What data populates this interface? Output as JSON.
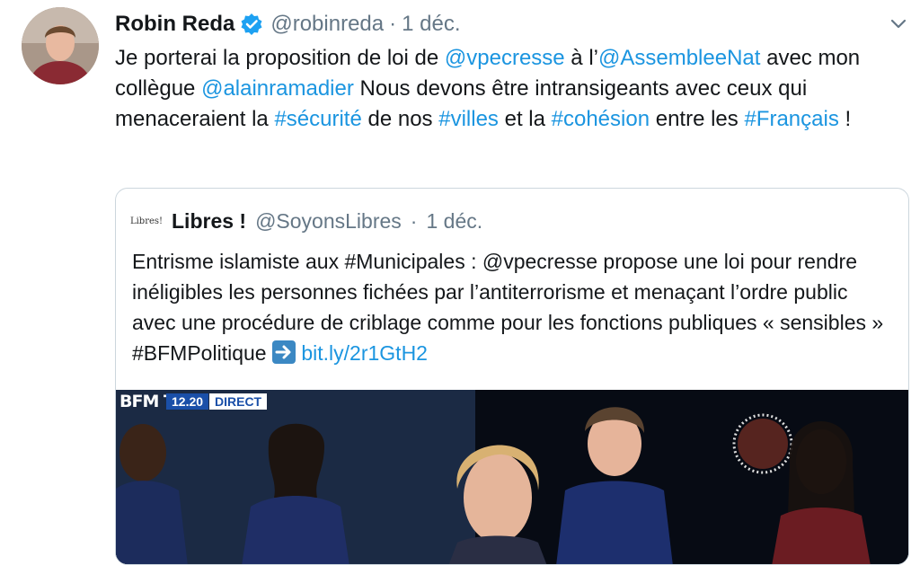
{
  "tweet": {
    "author_name": "Robin Reda",
    "handle": "@robinreda",
    "separator": "·",
    "date": "1 déc.",
    "text_parts": [
      {
        "t": "Je porterai la proposition de loi de ",
        "link": false
      },
      {
        "t": "@vpecresse",
        "link": true
      },
      {
        "t": " à l’",
        "link": false
      },
      {
        "t": "@AssembleeNat",
        "link": true
      },
      {
        "t": " avec mon collègue ",
        "link": false
      },
      {
        "t": "@alainramadier",
        "link": true
      },
      {
        "t": " Nous devons être intransigeants avec ceux qui menaceraient la ",
        "link": false
      },
      {
        "t": "#sécurité",
        "link": true
      },
      {
        "t": " de nos ",
        "link": false
      },
      {
        "t": "#villes",
        "link": true
      },
      {
        "t": " et la ",
        "link": false
      },
      {
        "t": "#cohésion",
        "link": true
      },
      {
        "t": " entre les ",
        "link": false
      },
      {
        "t": "#Français",
        "link": true
      },
      {
        "t": " !",
        "link": false
      }
    ]
  },
  "quoted": {
    "logo_text": "Libres!",
    "author_name": "Libres !",
    "handle": "@SoyonsLibres",
    "separator": "·",
    "date": "1 déc.",
    "text_before_arrow": "Entrisme islamiste aux #Municipales : @vpecresse propose une loi pour rendre inéligibles les personnes fichées par l’antiterrorisme et menaçant l’ordre public avec une procédure de criblage comme pour les fonctions publiques « sensibles » #BFMPolitique ",
    "link_after_arrow": "bit.ly/2r1GtH2",
    "image": {
      "channel_logo": "BFM TV.",
      "time": "12.20",
      "live_label": "DIRECT"
    }
  },
  "colors": {
    "link": "#1b95e0",
    "verified": "#1da1f2",
    "muted": "#657786",
    "border": "#ccd6dd"
  },
  "icons": [
    "verified-badge-icon",
    "chevron-down-icon",
    "right-arrow-emoji-icon"
  ]
}
